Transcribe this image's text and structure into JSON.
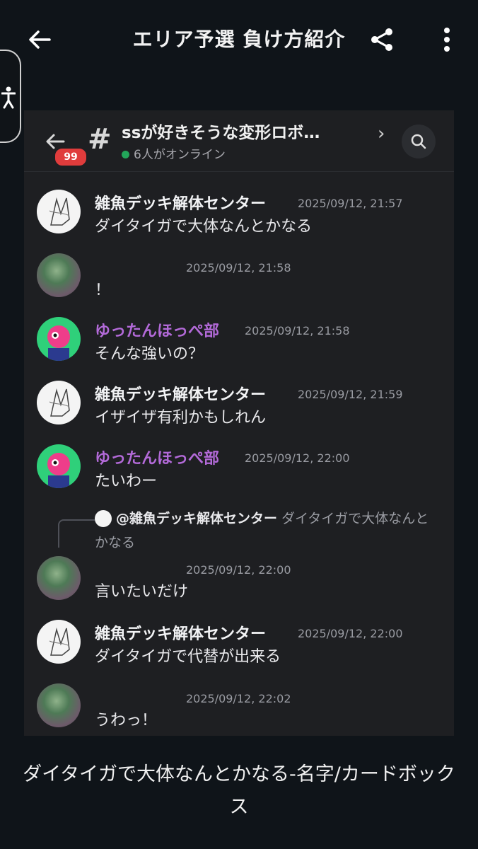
{
  "topbar": {
    "title": "エリア予選 負け方紹介",
    "back_icon": "arrow-left-icon",
    "share_icon": "share-icon",
    "more_icon": "more-vertical-icon"
  },
  "accessibility_icon": "accessibility-icon",
  "channel": {
    "badge": "99",
    "name": "ssが好きそうな変形ロボ…",
    "online": "6人がオンライン",
    "chevron": "›"
  },
  "messages": [
    {
      "author": "雑魚デッキ解体センター",
      "time": "2025/09/12, 21:57",
      "text": "ダイタイガで大体なんとかなる"
    },
    {
      "author": "",
      "time": "2025/09/12, 21:58",
      "text": "！"
    },
    {
      "author": "ゆったんほっぺ部",
      "time": "2025/09/12, 21:58",
      "text": "そんな強いの？"
    },
    {
      "author": "雑魚デッキ解体センター",
      "time": "2025/09/12, 21:59",
      "text": "イザイザ有利かもしれん"
    },
    {
      "author": "ゆったんほっぺ部",
      "time": "2025/09/12, 22:00",
      "text": "たいわー"
    },
    {
      "author": "",
      "time": "2025/09/12, 22:00",
      "text": "言いたいだけ",
      "reply": {
        "name": "@雑魚デッキ解体センター",
        "body": "ダイタイガで大体なんとかなる"
      }
    },
    {
      "author": "雑魚デッキ解体センター",
      "time": "2025/09/12, 22:00",
      "text": "ダイタイガで代替が出来る"
    },
    {
      "author": "",
      "time": "2025/09/12, 22:02",
      "text": "うわっ！"
    }
  ],
  "caption": "ダイタイガで大体なんとかなる-名字/カードボックス"
}
